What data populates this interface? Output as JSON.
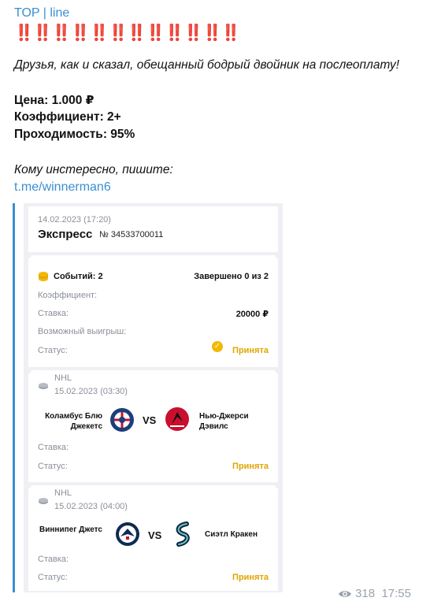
{
  "post": {
    "channel": "TOP | line",
    "bangs": "‼️‼️‼️‼️‼️‼️‼️‼️‼️‼️‼️‼️",
    "intro": "Друзья, как и сказал, обещанный бодрый двойник на послеоплату!",
    "price": "Цена: 1.000 ₽",
    "coef": "Коэффициент: 2+",
    "pass": "Проходимость: 95%",
    "ask": "Кому инстересно, пишите:",
    "link": "t.me/winnerman6",
    "views": "318",
    "time": "17:55"
  },
  "slip": {
    "date": "14.02.2023 (17:20)",
    "title": "Экспресс",
    "number": "№ 34533700011",
    "events": "Событий: 2",
    "done": "Завершено 0 из 2",
    "coef_label": "Коэффициент:",
    "stake_label": "Ставка:",
    "stake_value": "20000 ₽",
    "win_label": "Возможный выигрыш:",
    "status_label": "Статус:",
    "status_value": "Принята"
  },
  "matches": [
    {
      "league": "NHL",
      "date": "15.02.2023 (03:30)",
      "home": "Коламбус Блю Джекетс",
      "away": "Нью-Джерси Дэвилс",
      "vs": "VS",
      "stake_label": "Ставка:",
      "status_label": "Статус:",
      "status_value": "Принята",
      "home_color": "#1b3f7a",
      "away_color": "#c8102e"
    },
    {
      "league": "NHL",
      "date": "15.02.2023 (04:00)",
      "home": "Виннипег Джетс",
      "away": "Сиэтл Кракен",
      "vs": "VS",
      "stake_label": "Ставка:",
      "status_label": "Статус:",
      "status_value": "Принята",
      "home_color": "#0f2a52",
      "away_color": "#0a2540"
    }
  ],
  "icons": {
    "coin": "coin-stack-icon",
    "check": "check-circle-icon",
    "puck": "hockey-puck-icon",
    "eye": "eye-icon"
  },
  "colors": {
    "link": "#3a8fd0",
    "accent": "#f3b800",
    "bang": "#d0202a"
  }
}
